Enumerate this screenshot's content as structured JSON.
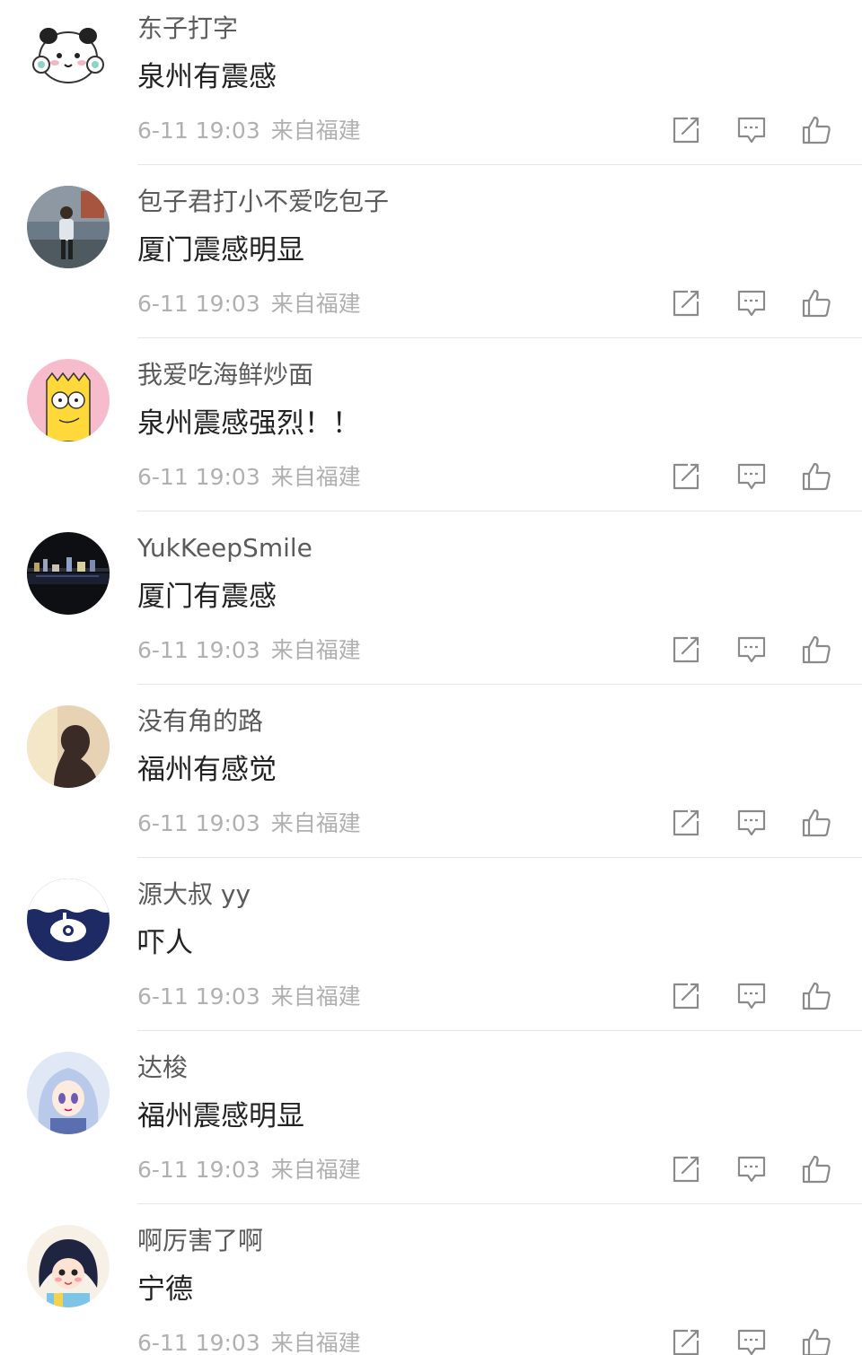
{
  "comments": [
    {
      "username": "东子打字",
      "content": "泉州有震感",
      "time": "6-11 19:03",
      "location": "来自福建",
      "avatar_icon": "panda-headphones-avatar"
    },
    {
      "username": "包子君打小不爱吃包子",
      "content": "厦门震感明显",
      "time": "6-11 19:03",
      "location": "来自福建",
      "avatar_icon": "girl-on-street-photo-avatar"
    },
    {
      "username": "我爱吃海鲜炒面",
      "content": "泉州震感强烈！！",
      "time": "6-11 19:03",
      "location": "来自福建",
      "avatar_icon": "bart-simpson-avatar"
    },
    {
      "username": "YukKeepSmile",
      "content": "厦门有震感",
      "time": "6-11 19:03",
      "location": "来自福建",
      "avatar_icon": "night-city-skyline-avatar"
    },
    {
      "username": "没有角的路",
      "content": "福州有感觉",
      "time": "6-11 19:03",
      "location": "来自福建",
      "avatar_icon": "silhouette-portrait-avatar"
    },
    {
      "username": "源大叔 yy",
      "content": "吓人",
      "time": "6-11 19:03",
      "location": "来自福建",
      "avatar_icon": "submarine-illustration-avatar"
    },
    {
      "username": "达梭",
      "content": "福州震感明显",
      "time": "6-11 19:03",
      "location": "来自福建",
      "avatar_icon": "anime-girl-avatar"
    },
    {
      "username": "啊厉害了啊",
      "content": "宁德",
      "time": "6-11 19:03",
      "location": "来自福建",
      "avatar_icon": "cartoon-girl-avatar"
    }
  ],
  "icons": {
    "share": "share-icon",
    "reply": "comment-icon",
    "like": "thumbs-up-icon"
  },
  "colors": {
    "username": "#5b5b5b",
    "content": "#222222",
    "meta": "#b0b0b0",
    "icon": "#8a8a8a",
    "divider": "#e6e6e6"
  }
}
